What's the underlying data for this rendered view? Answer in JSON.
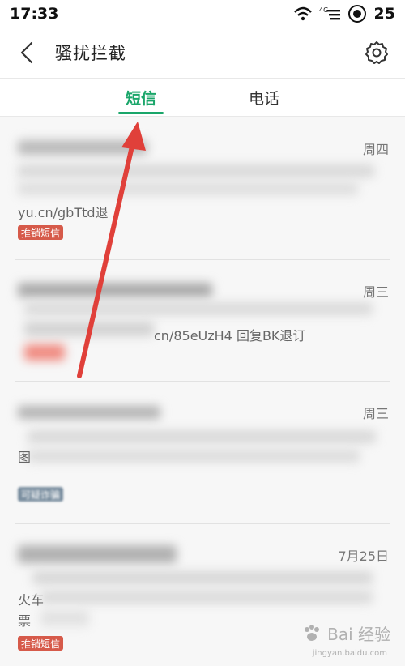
{
  "status_bar": {
    "time": "17:33",
    "battery": "25",
    "network_label": "4G"
  },
  "header": {
    "title": "骚扰拦截"
  },
  "tabs": [
    {
      "label": "短信",
      "active": true
    },
    {
      "label": "电话",
      "active": false
    }
  ],
  "messages": [
    {
      "date": "周四",
      "visible_text": "yu.cn/gbTtd退",
      "badge": "推销短信",
      "badge_color": "#d65a4a"
    },
    {
      "date": "周三",
      "visible_text": "cn/85eUzH4 回复BK退订",
      "badge": "",
      "badge_color": "#d65a4a"
    },
    {
      "date": "周三",
      "visible_text": "图",
      "badge": "可疑诈骗",
      "badge_color": "#7b8fa0"
    },
    {
      "date": "7月25日",
      "visible_text_line1": "火车",
      "visible_text_line2": "票",
      "badge": "推销短信",
      "badge_color": "#d65a4a"
    }
  ],
  "annotation": {
    "arrow_color": "#e0403a"
  },
  "watermark": {
    "brand": "Bai 经验",
    "sub": "jingyan.baidu.com"
  },
  "colors": {
    "accent": "#1aa66a",
    "divider": "#e2e2e2"
  }
}
